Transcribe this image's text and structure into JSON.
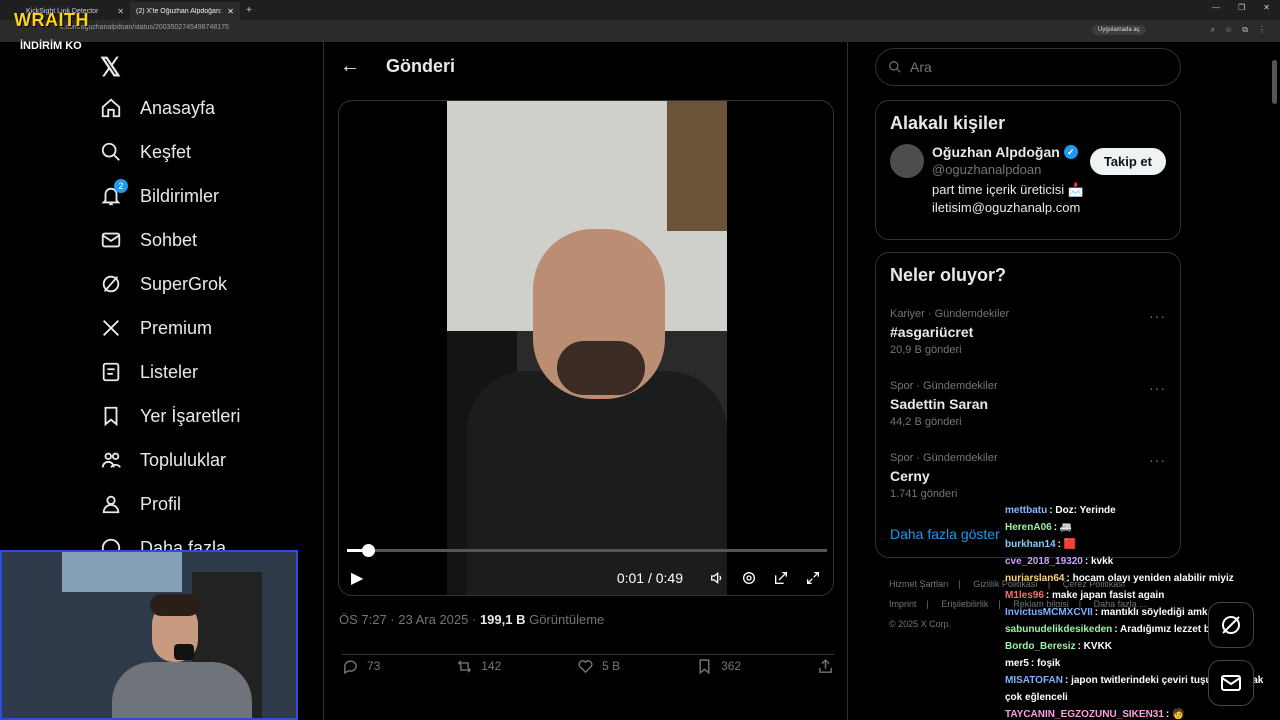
{
  "browser": {
    "tabs": [
      {
        "label": "KickSight Link Detector",
        "active": false
      },
      {
        "label": "(2) X'te Oğuzhan Alpdoğan: \"A",
        "active": true
      }
    ],
    "url": "x.com/oguzhanalpdoan/status/2003502745496748175",
    "open_app_label": "Uygulamada aç"
  },
  "overlay": {
    "logo": "WRAITH",
    "sub": "İNDİRİM KO"
  },
  "nav": {
    "logo_icon": "x-logo-icon",
    "notifications_badge": "2",
    "items": [
      {
        "label": "Anasayfa",
        "icon": "home-icon"
      },
      {
        "label": "Keşfet",
        "icon": "search-icon"
      },
      {
        "label": "Bildirimler",
        "icon": "bell-icon"
      },
      {
        "label": "Sohbet",
        "icon": "mail-icon"
      },
      {
        "label": "SuperGrok",
        "icon": "grok-icon"
      },
      {
        "label": "Premium",
        "icon": "x-icon"
      },
      {
        "label": "Listeler",
        "icon": "list-icon"
      },
      {
        "label": "Yer İşaretleri",
        "icon": "bookmark-icon"
      },
      {
        "label": "Topluluklar",
        "icon": "people-icon"
      },
      {
        "label": "Profil",
        "icon": "person-icon"
      },
      {
        "label": "Daha fazla",
        "icon": "more-icon"
      }
    ]
  },
  "post": {
    "header_title": "Gönderi",
    "video": {
      "time": "0:01 / 0:49",
      "progress": 0.04
    },
    "timestamp": "ÖS 7:27 · 23 Ara 2025 ·",
    "views_count": "199,1 B",
    "views_label": "Görüntüleme",
    "actions": {
      "replies": "73",
      "reposts": "142",
      "likes": "5 B",
      "bookmarks": "362"
    }
  },
  "sidebar": {
    "search_placeholder": "Ara",
    "related_title": "Alakalı kişiler",
    "person": {
      "name": "Oğuzhan Alpdoğan",
      "handle": "@oguzhanalpdoan",
      "bio_line1": "part time içerik üreticisi 📩",
      "bio_line2": "iletisim@oguzhanalp.com",
      "follow_label": "Takip et"
    },
    "trends_title": "Neler oluyor?",
    "trends": [
      {
        "category": "Kariyer · Gündemdekiler",
        "name": "#asgariücret",
        "count": "20,9 B gönderi"
      },
      {
        "category": "Spor · Gündemdekiler",
        "name": "Sadettin Saran",
        "count": "44,2 B gönderi"
      },
      {
        "category": "Spor · Gündemdekiler",
        "name": "Cerny",
        "count": "1.741 gönderi"
      }
    ],
    "show_more": "Daha fazla göster",
    "footer": {
      "line1": [
        "Hizmet Şartları",
        "Gizlilik Politikası",
        "Çerez Politikası"
      ],
      "line2": [
        "Imprint",
        "Erişilebilirlik",
        "Reklam bilgisi",
        "Daha fazla ..."
      ],
      "copyright": "© 2025 X Corp."
    }
  },
  "chat": [
    {
      "user": "mettbatu",
      "color": "#8fb7ff",
      "msg": ": Doz: Yerinde"
    },
    {
      "user": "HerenA06",
      "color": "#9ef0a5",
      "msg": ": 🚐"
    },
    {
      "user": "burkhan14",
      "color": "#7fd0ff",
      "msg": ": 🟥"
    },
    {
      "user": "cve_2018_19320",
      "color": "#c9a0ff",
      "msg": ": kvkk"
    },
    {
      "user": "nuriarslan64",
      "color": "#ffd27f",
      "msg": ": hocam olayı yeniden alabilir miyiz"
    },
    {
      "user": "M1les96",
      "color": "#ff6b6b",
      "msg": ": make japan fasist again"
    },
    {
      "user": "InvictusMCMXCVII",
      "color": "#7fb0ff",
      "msg": ": mantıklı söylediği amk nesi ırkçı"
    },
    {
      "user": "sabunudelikdesikeden",
      "color": "#9ef0a5",
      "msg": ": Aradığımız lezzet bu işte"
    },
    {
      "user": "Bordo_Beresiz",
      "color": "#9ef0a5",
      "msg": ": KVKK"
    },
    {
      "user": "mer5",
      "color": "#ffffff",
      "msg": ": foşik"
    },
    {
      "user": "MISATOFAN",
      "color": "#7fb0ff",
      "msg": ": japon twitlerindeki çeviri tuşuna basmak çok eğlenceli"
    },
    {
      "user": "TAYCANIN_EGZOZUNU_SIKEN31",
      "color": "#ff9de2",
      "msg": ": 🧑"
    }
  ]
}
